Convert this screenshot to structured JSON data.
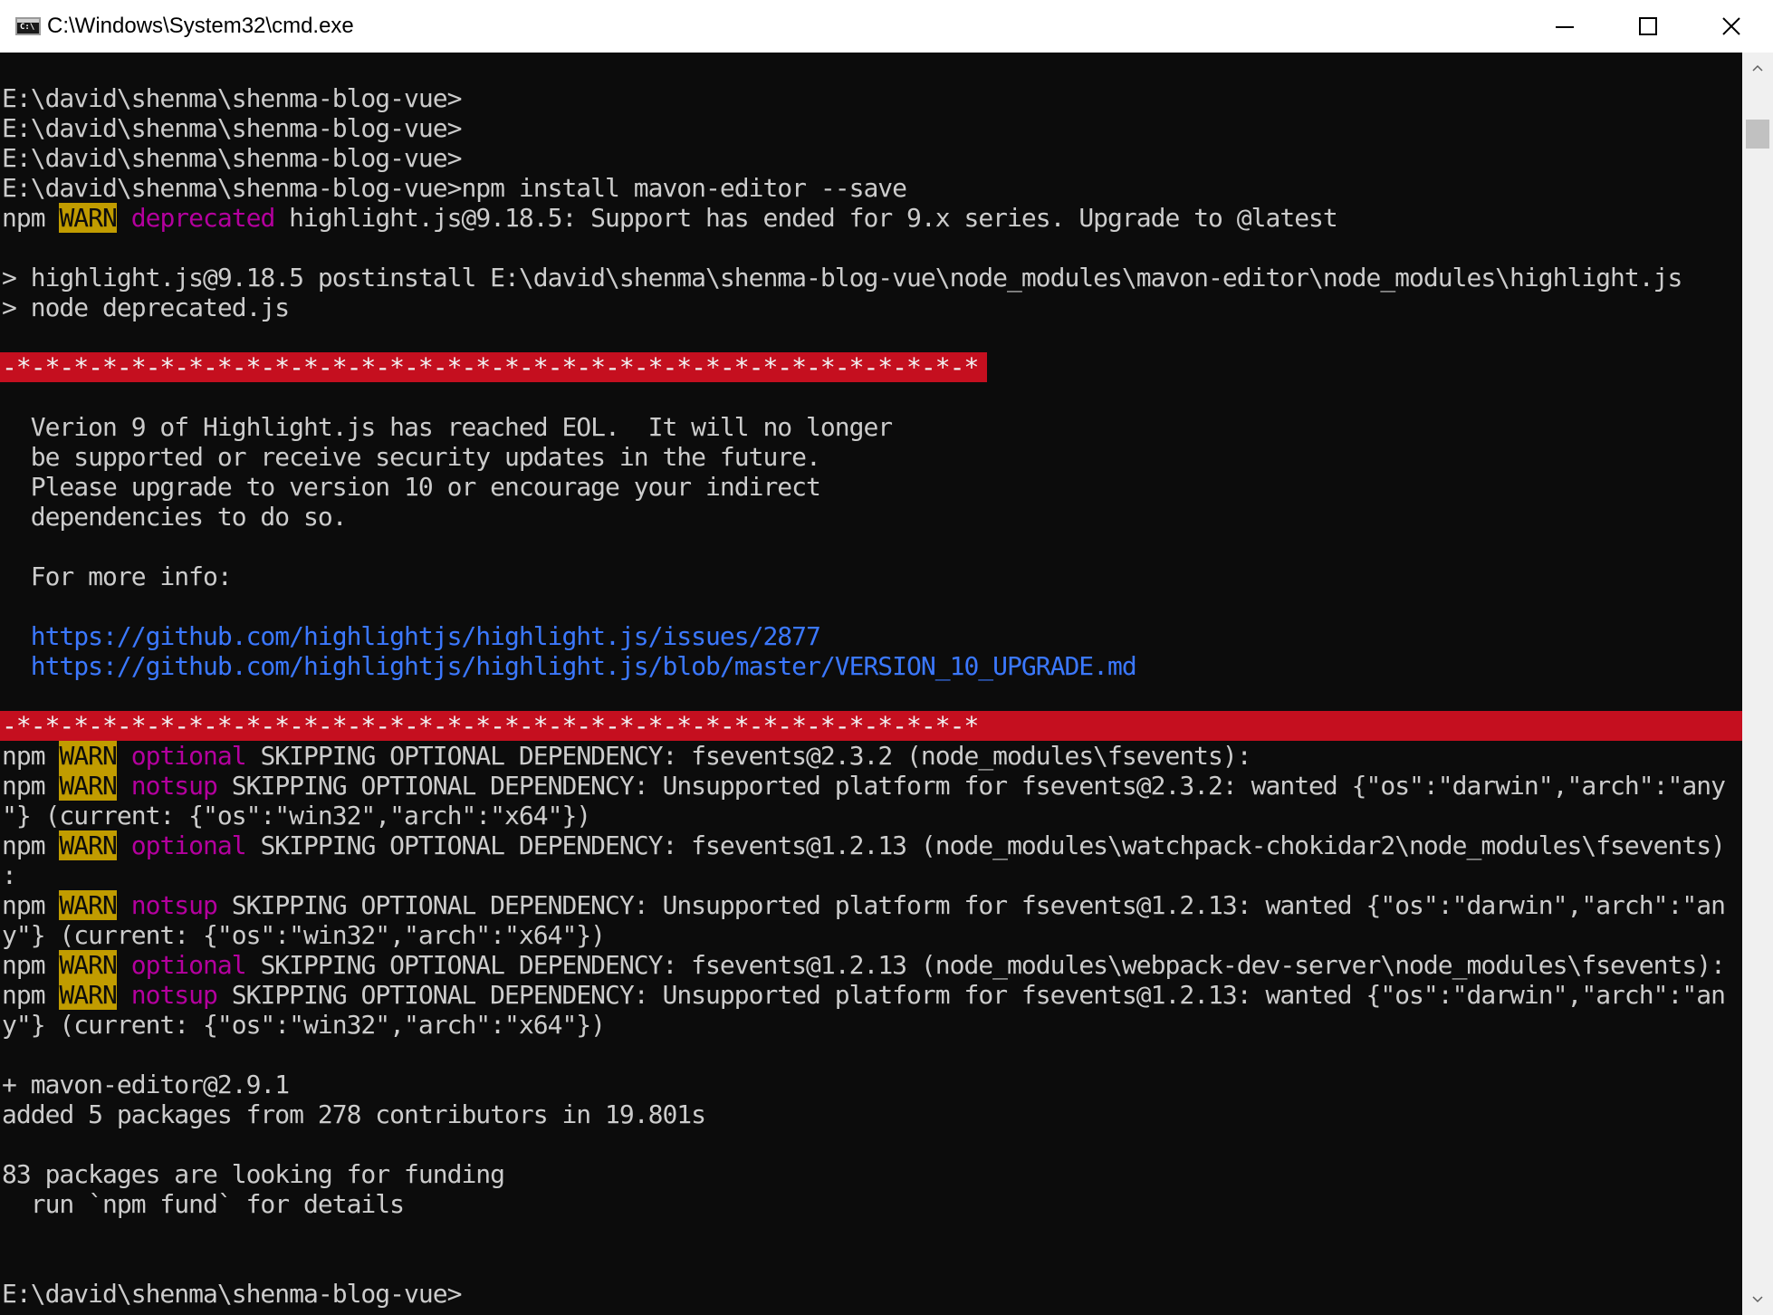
{
  "window": {
    "title": "C:\\Windows\\System32\\cmd.exe",
    "icon_name": "cmd-icon",
    "icon_text": "C:\\"
  },
  "colors": {
    "background": "#0c0c0c",
    "text": "#cccccc",
    "warn_bg": "#c19c00",
    "magenta": "#881798",
    "link_blue": "#3b78ff",
    "red_bar": "#c50f1f"
  },
  "console": {
    "prompt_lines": [
      "E:\\david\\shenma\\shenma-blog-vue>",
      "E:\\david\\shenma\\shenma-blog-vue>",
      "E:\\david\\shenma\\shenma-blog-vue>",
      "E:\\david\\shenma\\shenma-blog-vue>npm install mavon-editor --save"
    ],
    "deprecated_line": {
      "prefix": "npm ",
      "warn": "WARN",
      "tag": " deprecated",
      "message": " highlight.js@9.18.5: Support has ended for 9.x series. Upgrade to @latest"
    },
    "postinstall_lines": [
      "> highlight.js@9.18.5 postinstall E:\\david\\shenma\\shenma-blog-vue\\node_modules\\mavon-editor\\node_modules\\highlight.js",
      "> node deprecated.js"
    ],
    "stars": "-*-*-*-*-*-*-*-*-*-*-*-*-*-*-*-*-*-*-*-*-*-*-*-*-*-*-*-*-*-*-*-*-*-*",
    "eol_notice": [
      "  Verion 9 of Highlight.js has reached EOL.  It will no longer",
      "  be supported or receive security updates in the future.",
      "  Please upgrade to version 10 or encourage your indirect",
      "  dependencies to do so."
    ],
    "more_info": "  For more info:",
    "links": [
      "  https://github.com/highlightjs/highlight.js/issues/2877",
      "  https://github.com/highlightjs/highlight.js/blob/master/VERSION_10_UPGRADE.md"
    ],
    "warn_lines": [
      {
        "tag": " optional",
        "message": " SKIPPING OPTIONAL DEPENDENCY: fsevents@2.3.2 (node_modules\\fsevents):"
      },
      {
        "tag": " notsup",
        "message": " SKIPPING OPTIONAL DEPENDENCY: Unsupported platform for fsevents@2.3.2: wanted {\"os\":\"darwin\",\"arch\":\"any"
      },
      {
        "continuation": "\"} (current: {\"os\":\"win32\",\"arch\":\"x64\"})"
      },
      {
        "tag": " optional",
        "message": " SKIPPING OPTIONAL DEPENDENCY: fsevents@1.2.13 (node_modules\\watchpack-chokidar2\\node_modules\\fsevents)"
      },
      {
        "continuation": ":"
      },
      {
        "tag": " notsup",
        "message": " SKIPPING OPTIONAL DEPENDENCY: Unsupported platform for fsevents@1.2.13: wanted {\"os\":\"darwin\",\"arch\":\"an"
      },
      {
        "continuation": "y\"} (current: {\"os\":\"win32\",\"arch\":\"x64\"})"
      },
      {
        "tag": " optional",
        "message": " SKIPPING OPTIONAL DEPENDENCY: fsevents@1.2.13 (node_modules\\webpack-dev-server\\node_modules\\fsevents):"
      },
      {
        "tag": " notsup",
        "message": " SKIPPING OPTIONAL DEPENDENCY: Unsupported platform for fsevents@1.2.13: wanted {\"os\":\"darwin\",\"arch\":\"an"
      },
      {
        "continuation": "y\"} (current: {\"os\":\"win32\",\"arch\":\"x64\"})"
      }
    ],
    "npm_prefix": "npm ",
    "warn_label": "WARN",
    "result_lines": [
      "+ mavon-editor@2.9.1",
      "added 5 packages from 278 contributors in 19.801s"
    ],
    "funding_lines": [
      "83 packages are looking for funding",
      "  run `npm fund` for details"
    ],
    "final_prompt": "E:\\david\\shenma\\shenma-blog-vue>"
  }
}
